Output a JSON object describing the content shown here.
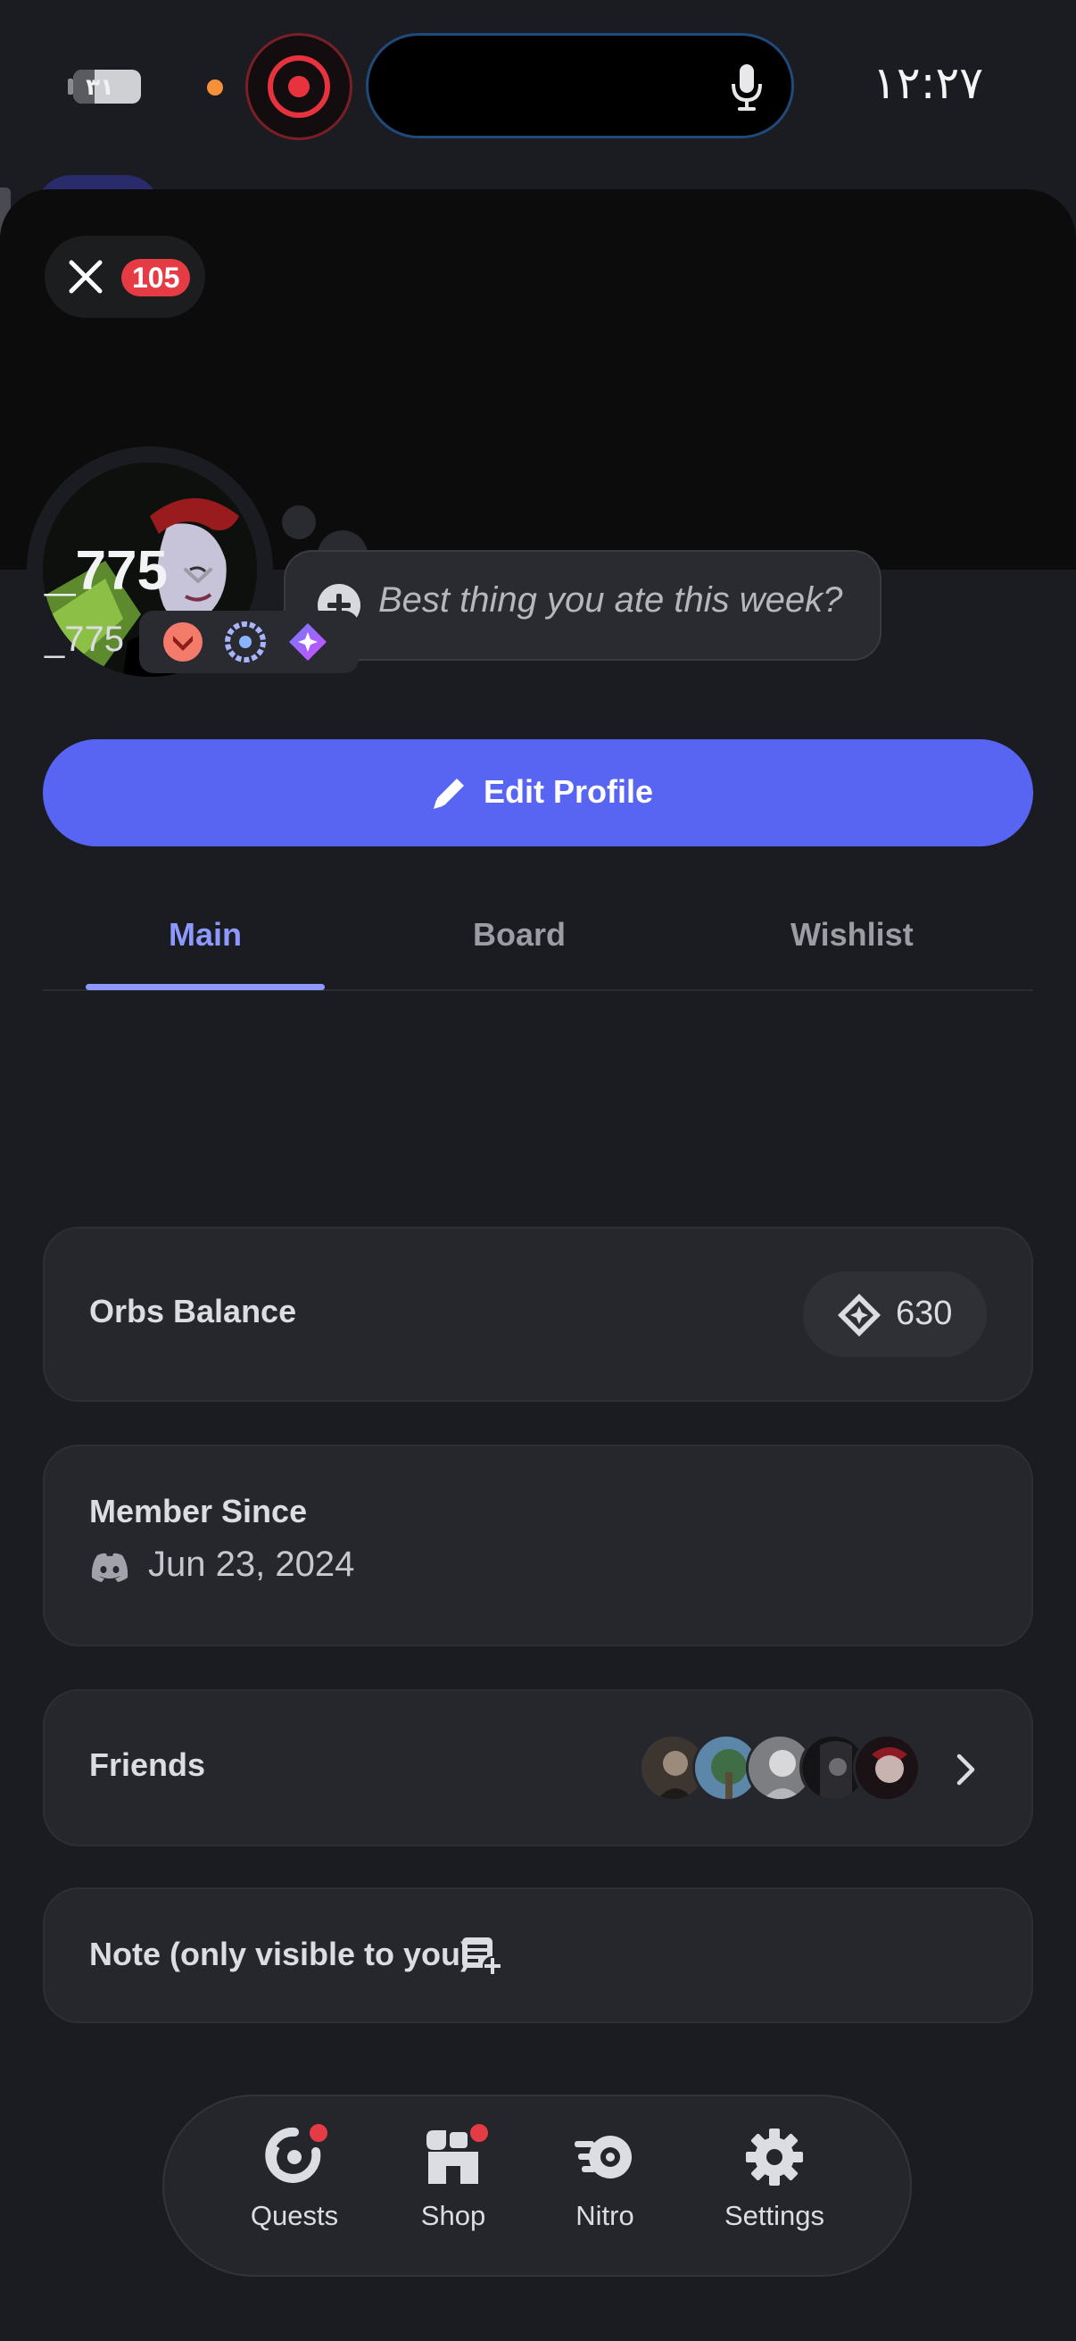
{
  "status_bar": {
    "battery": "۳۱",
    "battery_level": 0.31,
    "time": "۱۲:۲۷"
  },
  "header": {
    "unread_count": "105"
  },
  "profile": {
    "status_prompt": "Best thing you ate this week?",
    "display_name": "_775",
    "username": "_775",
    "badges": [
      "hypesquad-badge",
      "quest-badge",
      "orb-badge"
    ]
  },
  "actions": {
    "edit_profile": "Edit Profile"
  },
  "tabs": [
    {
      "label": "Main",
      "active": true
    },
    {
      "label": "Board",
      "active": false
    },
    {
      "label": "Wishlist",
      "active": false
    }
  ],
  "orbs": {
    "title": "Orbs Balance",
    "value": "630"
  },
  "member": {
    "title": "Member Since",
    "date": "Jun 23, 2024"
  },
  "friends": {
    "title": "Friends",
    "avatar_count": 5
  },
  "note": {
    "title": "Note (only visible to you)"
  },
  "bottom_nav": [
    {
      "label": "Quests",
      "icon": "quests-icon",
      "has_dot": true
    },
    {
      "label": "Shop",
      "icon": "shop-icon",
      "has_dot": true
    },
    {
      "label": "Nitro",
      "icon": "nitro-icon",
      "has_dot": false
    },
    {
      "label": "Settings",
      "icon": "settings-icon",
      "has_dot": false
    }
  ],
  "colors": {
    "background": "#1b1c21",
    "card": "#26272d",
    "brand": "#5865f2",
    "accent_tab": "#8e99ff",
    "alert": "#e53b45"
  }
}
